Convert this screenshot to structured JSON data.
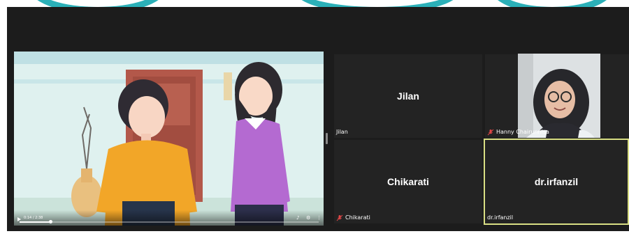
{
  "video": {
    "time": "0:14 / 2:38",
    "progress_fraction": 0.105,
    "controls": {
      "volume_icon": "volume-icon",
      "settings_icon": "settings-icon",
      "more_icon": "more-vert-icon"
    }
  },
  "participants": [
    {
      "tile_name": "Jilan",
      "label": "Jilan",
      "muted": false,
      "video_on": false,
      "active": false
    },
    {
      "tile_name": "",
      "label": "Hanny Chairunnisa",
      "muted": true,
      "video_on": true,
      "active": false
    },
    {
      "tile_name": "Chikarati",
      "label": "Chikarati",
      "muted": true,
      "video_on": false,
      "active": false
    },
    {
      "tile_name": "dr.irfanzil",
      "label": "dr.irfanzil",
      "muted": false,
      "video_on": false,
      "active": true
    }
  ],
  "colors": {
    "active_speaker_border": "#d9df84",
    "mute_icon": "#e04747",
    "tile_bg": "#232323",
    "meeting_bg": "#1c1c1c"
  }
}
